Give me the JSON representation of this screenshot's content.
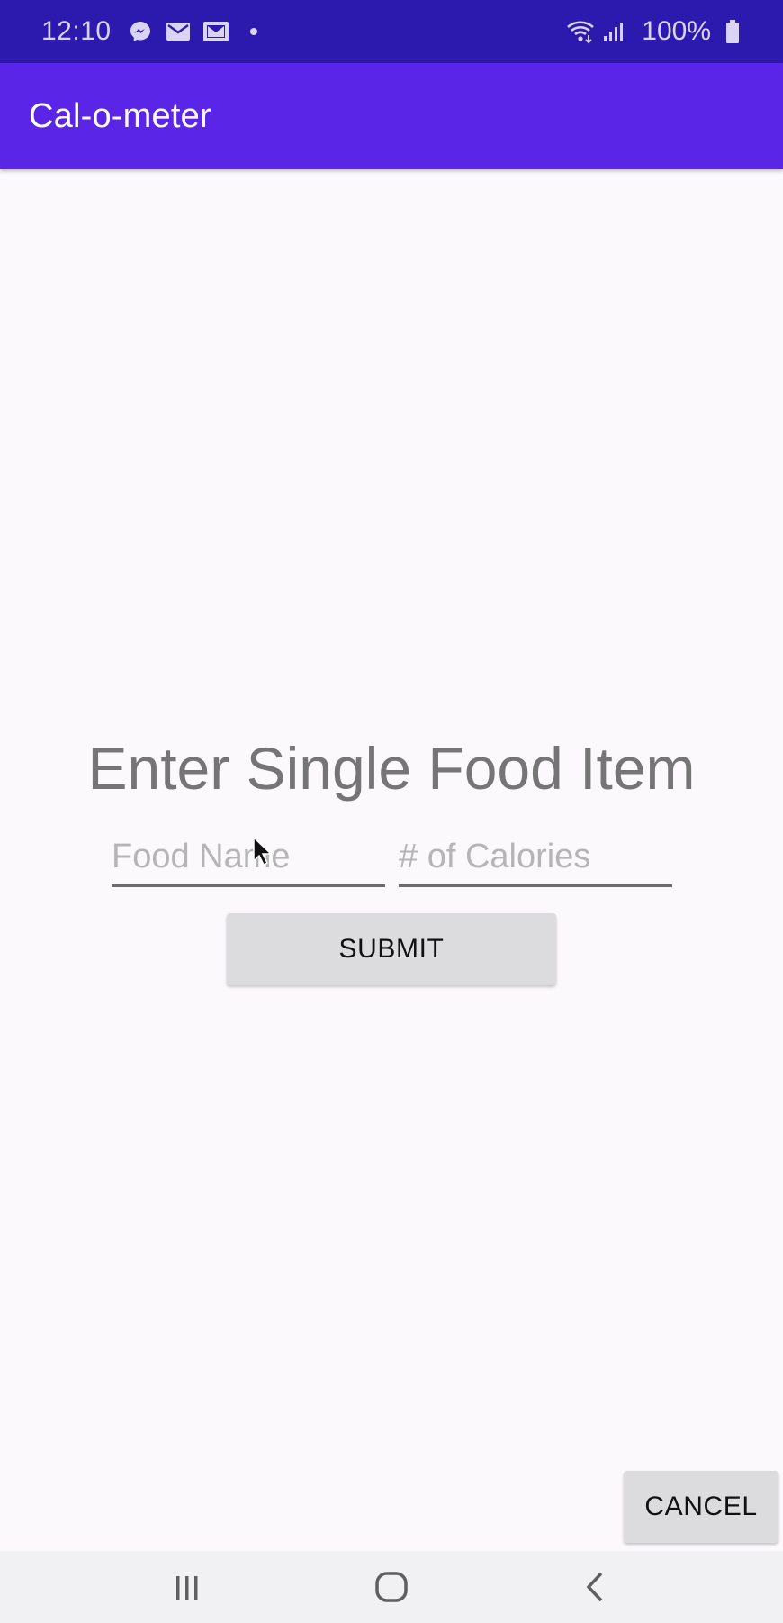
{
  "status_bar": {
    "time": "12:10",
    "battery_percent": "100%",
    "icons_left": [
      "messenger-icon",
      "mail-icon",
      "gmail-icon",
      "dot-icon"
    ],
    "icons_right": [
      "wifi-icon",
      "signal-icon",
      "battery-icon"
    ]
  },
  "app_bar": {
    "title": "Cal-o-meter",
    "color": "#5a25e6"
  },
  "form": {
    "heading": "Enter Single Food Item",
    "food_name_placeholder": "Food Name",
    "calories_placeholder": "# of Calories",
    "submit_label": "SUBMIT"
  },
  "footer": {
    "cancel_label": "CANCEL"
  },
  "nav_bar": {
    "icons": [
      "recents-icon",
      "home-icon",
      "back-icon"
    ]
  }
}
